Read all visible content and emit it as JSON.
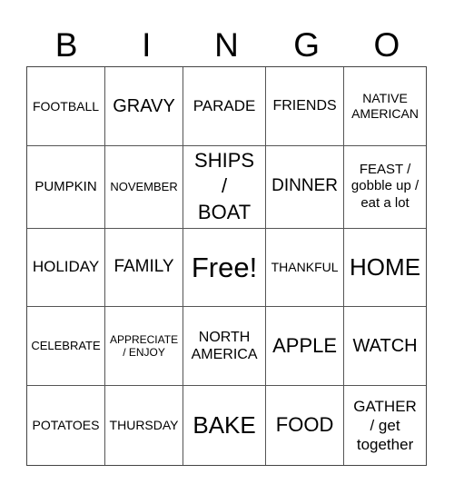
{
  "header": {
    "letters": [
      "B",
      "I",
      "N",
      "G",
      "O"
    ]
  },
  "board": {
    "rows": [
      [
        "FOOTBALL",
        "GRAVY",
        "PARADE",
        "FRIENDS",
        "NATIVE AMERICAN"
      ],
      [
        "PUMPKIN",
        "NOVEMBER",
        "SHIPS / BOAT",
        "DINNER",
        "FEAST / gobble up / eat a lot"
      ],
      [
        "HOLIDAY",
        "FAMILY",
        "Free!",
        "THANKFUL",
        "HOME"
      ],
      [
        "CELEBRATE",
        "APPRECIATE / ENJOY",
        "NORTH AMERICA",
        "APPLE",
        "WATCH"
      ],
      [
        "POTATOES",
        "THURSDAY",
        "BAKE",
        "FOOD",
        "GATHER / get together"
      ]
    ],
    "free_space": "Free!",
    "line_color": "#444444"
  }
}
